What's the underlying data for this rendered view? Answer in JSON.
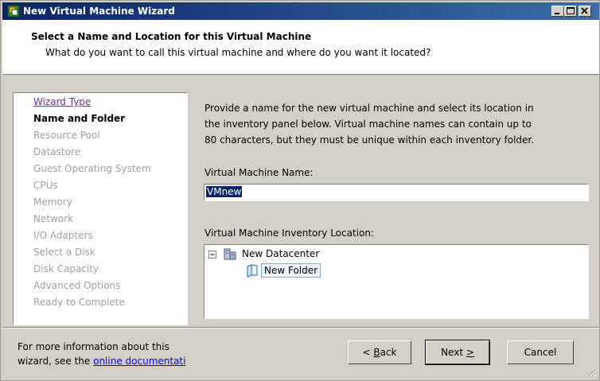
{
  "window": {
    "title": "New Virtual Machine Wizard",
    "icon": "vm-wizard-icon"
  },
  "header": {
    "title": "Select a Name and Location for this Virtual Machine",
    "subtitle": "What do you want to call this virtual machine and where do you want it located?"
  },
  "steps": [
    {
      "label": "Wizard Type",
      "state": "done"
    },
    {
      "label": "Name and Folder",
      "state": "current"
    },
    {
      "label": "Resource Pool",
      "state": "pending"
    },
    {
      "label": "Datastore",
      "state": "pending"
    },
    {
      "label": "Guest Operating System",
      "state": "pending"
    },
    {
      "label": "CPUs",
      "state": "pending"
    },
    {
      "label": "Memory",
      "state": "pending"
    },
    {
      "label": "Network",
      "state": "pending"
    },
    {
      "label": "I/O Adapters",
      "state": "pending"
    },
    {
      "label": "Select a Disk",
      "state": "pending"
    },
    {
      "label": "Disk Capacity",
      "state": "pending"
    },
    {
      "label": "Advanced Options",
      "state": "pending"
    },
    {
      "label": "Ready to Complete",
      "state": "pending"
    }
  ],
  "main": {
    "description_lines": [
      "Provide a name for the new virtual machine and select its location in",
      "the inventory panel below. Virtual machine names can contain up to",
      "80 characters, but they must be unique within each inventory folder."
    ],
    "name_label": "Virtual Machine Name:",
    "name_value": "VMnew",
    "location_label": "Virtual Machine Inventory Location:",
    "tree": {
      "datacenter": {
        "label": "New Datacenter",
        "icon": "datacenter-icon",
        "expanded": true
      },
      "folder": {
        "label": "New Folder",
        "icon": "folder-icon",
        "selected": true
      }
    }
  },
  "footer": {
    "help_line1": "For more information about this",
    "help_line2_prefix": "wizard, see the ",
    "help_link": "online documentati"
  },
  "buttons": {
    "back": {
      "pre": "",
      "accel": "B",
      "post": "ack",
      "prefix": "< "
    },
    "next": {
      "pre": "Next ",
      "accel": ">",
      "post": ""
    },
    "cancel": "Cancel"
  },
  "colors": {
    "titlebar_start": "#0a246a",
    "titlebar_end": "#3a6ea5",
    "visited_step": "#7030a0",
    "pending_step": "#a0a0a0",
    "link": "#0000ee"
  }
}
